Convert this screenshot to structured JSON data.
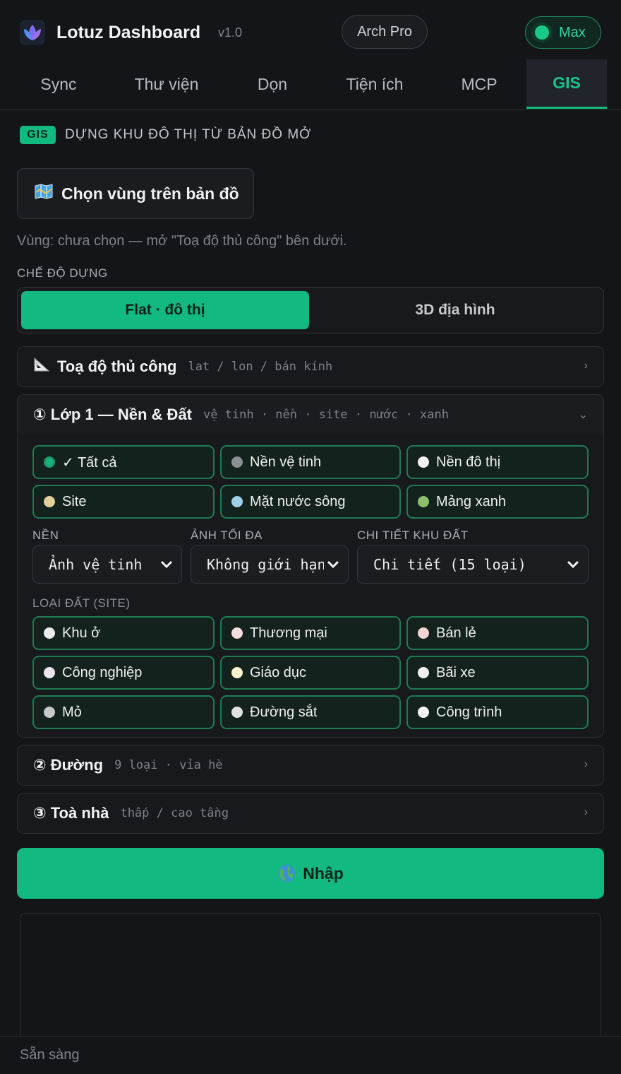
{
  "app": {
    "title": "Lotuz Dashboard",
    "version": "v1.0",
    "badge": "Arch Pro",
    "mode_toggle": "Max"
  },
  "tabs": [
    {
      "label": "Sync"
    },
    {
      "label": "Thư viện"
    },
    {
      "label": "Dọn"
    },
    {
      "label": "Tiện ích"
    },
    {
      "label": "MCP"
    },
    {
      "label": "GIS",
      "active": true
    }
  ],
  "section": {
    "badge": "GIS",
    "title": "DỰNG KHU ĐÔ THỊ TỪ BẢN ĐỒ MỞ"
  },
  "pick_region": {
    "label": "Chọn vùng trên bản đồ",
    "icon": "map-icon"
  },
  "region_status": "Vùng: chưa chọn — mở \"Toạ độ thủ công\" bên dưới.",
  "build_mode": {
    "label": "CHẾ ĐỘ DỰNG",
    "options": [
      "Flat · đô thị",
      "3D địa hình"
    ],
    "selected": "Flat · đô thị"
  },
  "manual_coords": {
    "title": "Toạ độ thủ công",
    "subtitle": "lat / lon / bán kính",
    "icon": "triangle-ruler-icon"
  },
  "layer1": {
    "title": "① Lớp 1 — Nền & Đất",
    "subtitle": "vệ tinh · nền · site · nước · xanh",
    "layers": [
      {
        "label": "✓ Tất cả",
        "color": "#16b47c"
      },
      {
        "label": "Nền vệ tinh",
        "color": "#8a8f94"
      },
      {
        "label": "Nền đô thị",
        "color": "#f4f4f4"
      },
      {
        "label": "Site",
        "color": "#e3cf9a"
      },
      {
        "label": "Mặt nước sông",
        "color": "#9fd0e8"
      },
      {
        "label": "Mảng xanh",
        "color": "#8fbf6a"
      }
    ],
    "base": {
      "label": "NỀN",
      "value": "Ảnh vệ tinh"
    },
    "max_images": {
      "label": "ẢNH TỐI ĐA",
      "value": "Không giới hạn"
    },
    "land_detail": {
      "label": "CHI TIẾT KHU ĐẤT",
      "value": "Chi tiết (15 loại)"
    },
    "site_types_label": "LOẠI ĐẤT (SITE)",
    "site_types": [
      {
        "label": "Khu ở",
        "color": "#ececec"
      },
      {
        "label": "Thương mại",
        "color": "#f2dede"
      },
      {
        "label": "Bán lẻ",
        "color": "#f4d4d0"
      },
      {
        "label": "Công nghiệp",
        "color": "#eee4ef"
      },
      {
        "label": "Giáo dục",
        "color": "#fbf3cf"
      },
      {
        "label": "Bãi xe",
        "color": "#f1f1f1"
      },
      {
        "label": "Mỏ",
        "color": "#c8c8c8"
      },
      {
        "label": "Đường sắt",
        "color": "#e2e2e2"
      },
      {
        "label": "Công trình",
        "color": "#f4f4f4"
      }
    ]
  },
  "roads": {
    "title": "② Đường",
    "subtitle": "9 loại · vỉa hè"
  },
  "buildings": {
    "title": "③ Toà nhà",
    "subtitle": "thấp / cao tầng"
  },
  "import_button": {
    "label": "Nhập",
    "icon": "globe-icon"
  },
  "status": "Sẵn sàng"
}
